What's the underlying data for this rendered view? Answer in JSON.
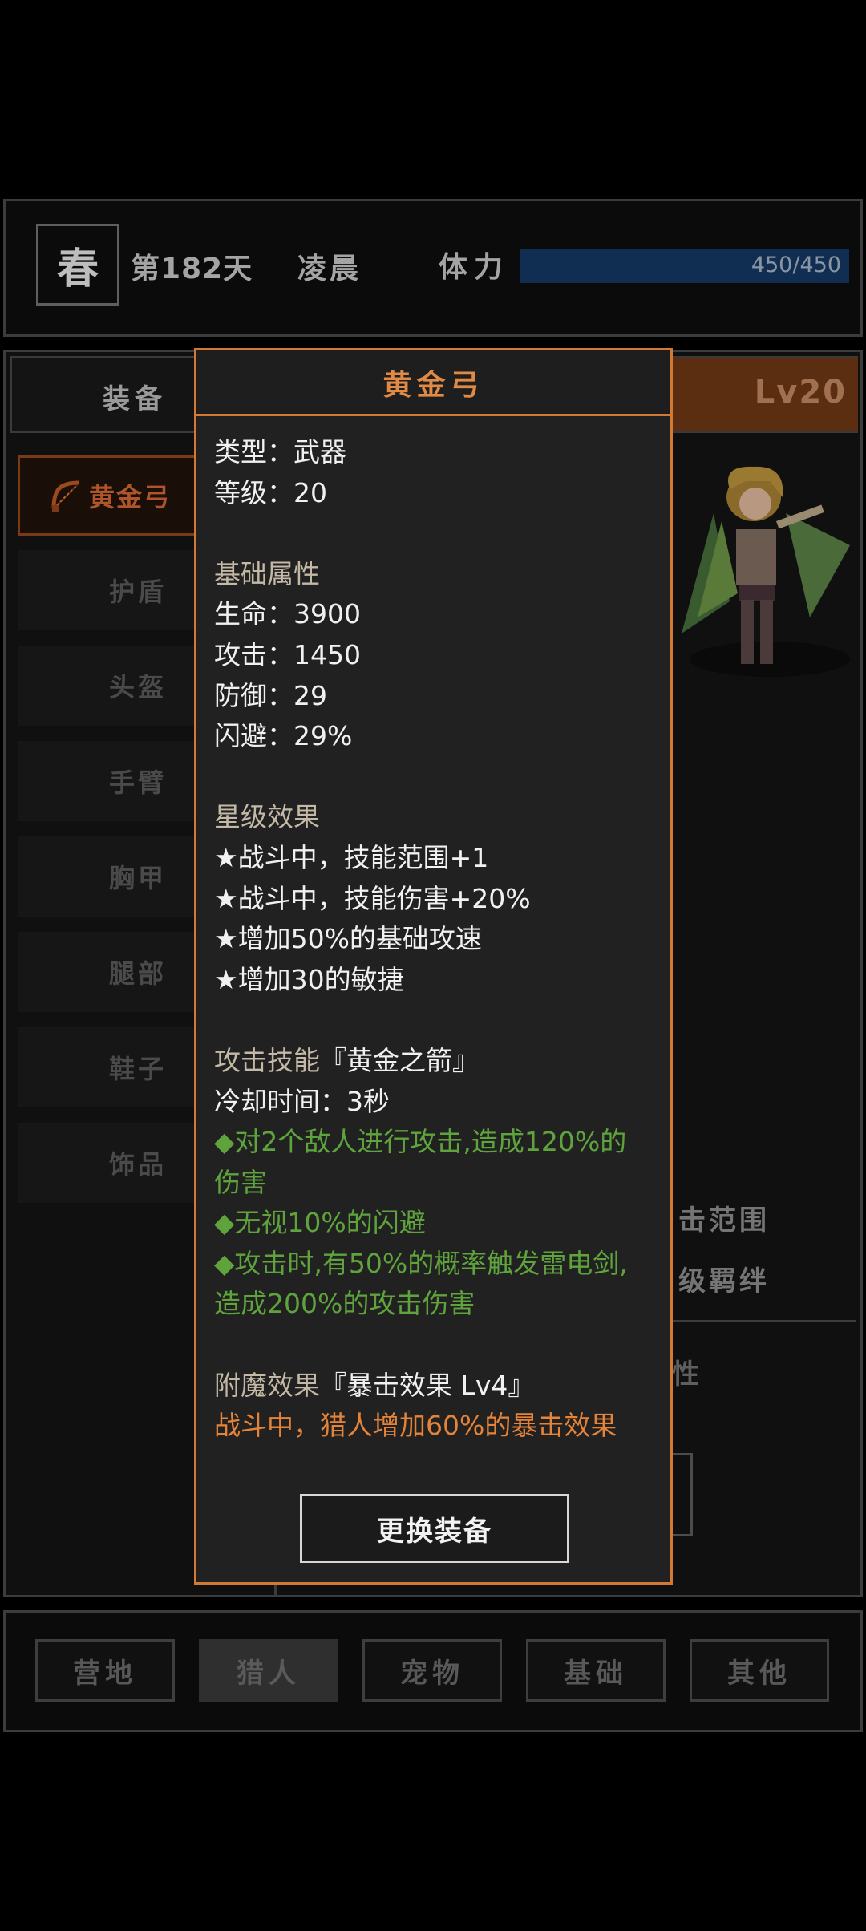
{
  "status_bar": {
    "season": "春",
    "day": "第182天",
    "time_of_day": "凌晨",
    "stamina_label": "体力",
    "stamina_text": "450/450",
    "stamina_fraction": 1.0
  },
  "tabs": {
    "equipment": "装备",
    "level": "Lv20"
  },
  "equipment_slots": [
    {
      "label": "黄金弓",
      "active": true
    },
    {
      "label": "护盾"
    },
    {
      "label": "头盔"
    },
    {
      "label": "手臂"
    },
    {
      "label": "胸甲"
    },
    {
      "label": "腿部"
    },
    {
      "label": "鞋子"
    },
    {
      "label": "饰品"
    }
  ],
  "background_fragments": {
    "skill_range": "击范围",
    "bond": "级羁绊",
    "attr": "性"
  },
  "item_popup": {
    "title": "黄金弓",
    "type_line": "类型：武器",
    "level_line": "等级：20",
    "base_attr_header": "基础属性",
    "hp_line": "生命：3900",
    "atk_line": "攻击：1450",
    "def_line": "防御：29",
    "dodge_line": "闪避：29%",
    "star_header": "星级效果",
    "star_effects": [
      "★战斗中，技能范围+1",
      "★战斗中，技能伤害+20%",
      "★增加50%的基础攻速",
      "★增加30的敏捷"
    ],
    "skill_prefix": "攻击技能",
    "skill_name": "『黄金之箭』",
    "cooldown_line": "冷却时间：3秒",
    "skill_effects_lines": [
      "◆对2个敌人进行攻击,造成120%的",
      "伤害",
      "◆无视10%的闪避",
      "◆攻击时,有50%的概率触发雷电剑,",
      "造成200%的攻击伤害"
    ],
    "enchant_prefix": "附魔效果",
    "enchant_name": "『暴击效果 Lv4』",
    "enchant_desc": "战斗中，猎人增加60%的暴击效果",
    "change_button": "更换装备"
  },
  "bottom_nav": [
    {
      "label": "营地",
      "active": false
    },
    {
      "label": "猎人",
      "active": true
    },
    {
      "label": "宠物",
      "active": false
    },
    {
      "label": "基础",
      "active": false
    },
    {
      "label": "其他",
      "active": false
    }
  ],
  "colors": {
    "accent_orange": "#d27a35",
    "green_text": "#5ea33c",
    "stamina_bar": "#0f2e52"
  }
}
